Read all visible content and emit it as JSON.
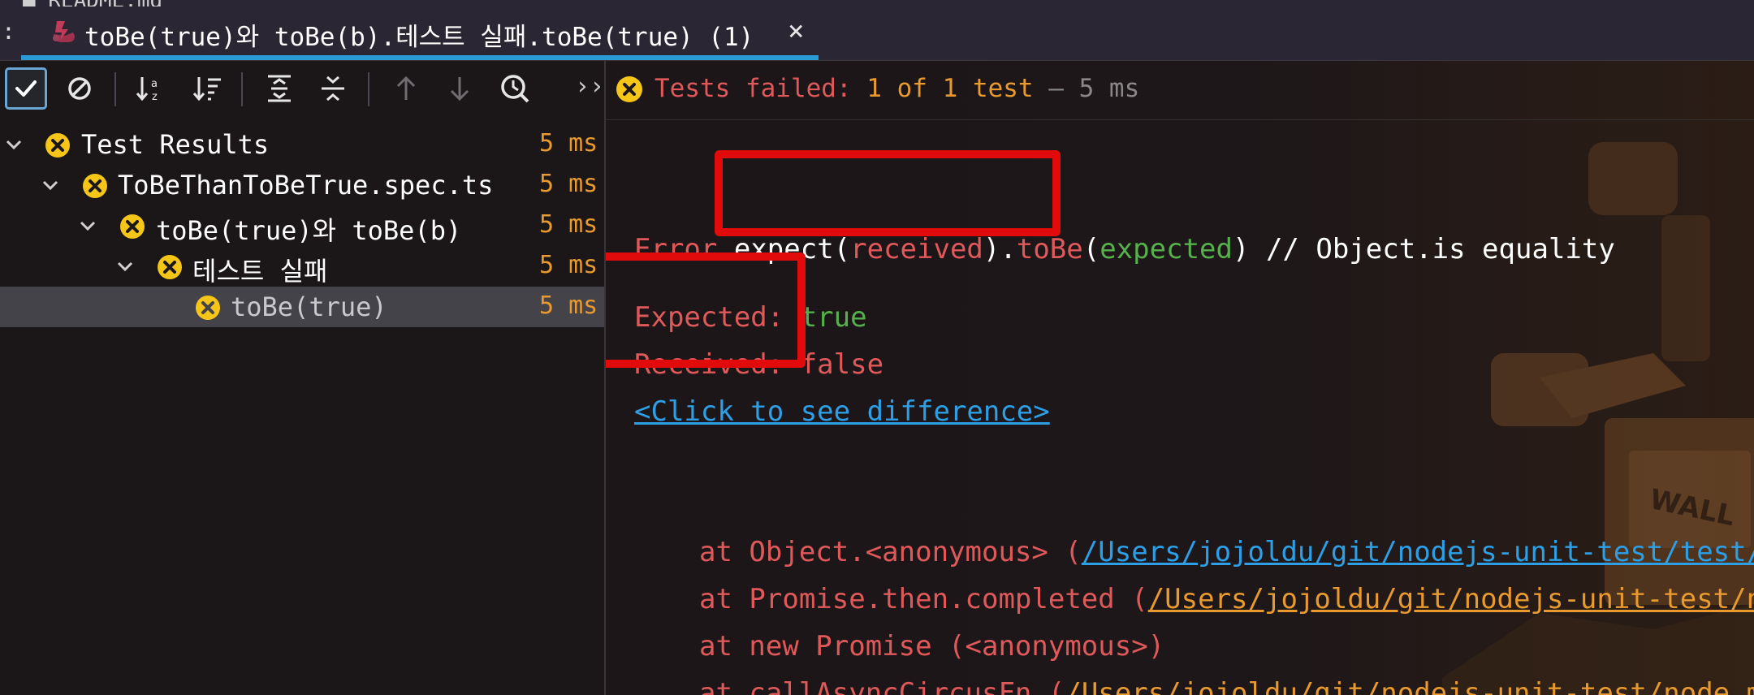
{
  "topstrip": {
    "partial_text": "■ README.md"
  },
  "tab": {
    "title": "toBe(true)와 toBe(b).테스트 실패.toBe(true) (1)",
    "close_glyph": "×",
    "menu_glyph": ":"
  },
  "toolbar": {
    "buttons": [
      {
        "icon": "checkmark-icon",
        "active": true
      },
      {
        "icon": "cancel-circle-icon"
      },
      {
        "icon": "sort-alphabetical-icon"
      },
      {
        "icon": "sort-by-duration-icon"
      },
      {
        "icon": "expand-all-icon"
      },
      {
        "icon": "collapse-all-icon"
      },
      {
        "icon": "arrow-up-icon",
        "disabled": true
      },
      {
        "icon": "arrow-down-icon",
        "disabled": true
      },
      {
        "icon": "history-icon"
      }
    ],
    "more_glyph": "››"
  },
  "tree": {
    "items": [
      {
        "label": "Test Results",
        "duration": "5 ms",
        "level": 0
      },
      {
        "label": "ToBeThanToBeTrue.spec.ts",
        "duration": "5 ms",
        "level": 1
      },
      {
        "label": "toBe(true)와 toBe(b)",
        "duration": "5 ms",
        "level": 2
      },
      {
        "label": "테스트 실패",
        "duration": "5 ms",
        "level": 3
      },
      {
        "label": "toBe(true)",
        "duration": "5 ms",
        "level": 4,
        "selected": true
      }
    ]
  },
  "status": {
    "prefix": "Tests failed: ",
    "count": "1 of 1 test",
    "sep": " – ",
    "time": "5 ms"
  },
  "console": {
    "error_label": "Error",
    "expect_fn": "expect(",
    "received_arg": "received",
    "close_paren1": ").",
    "tobe_fn": "toBe",
    "open_paren": "(",
    "expected_arg": "expected",
    "close_paren2": ")",
    "comment": " // Object.is equality",
    "expected_label": "Expected: ",
    "expected_value": "true",
    "received_label": "Received: ",
    "received_value": "false",
    "diff_link": "<Click to see difference>",
    "stack": [
      {
        "prefix": "at Object.<anonymous> (",
        "link": "/Users/jojoldu/git/nodejs-unit-test/test/t",
        "link_color": "blue"
      },
      {
        "prefix": "at Promise.then.completed (",
        "link": "/Users/jojoldu/git/nodejs-unit-test/no",
        "link_color": "orange"
      },
      {
        "prefix": "at new Promise (<anonymous>)",
        "link": "",
        "link_color": "none"
      },
      {
        "prefix": "at callAsyncCircusFn (",
        "link": "/Users/jojoldu/git/nodejs-unit-test/node_mo",
        "link_color": "orange"
      }
    ]
  },
  "colors": {
    "fail_icon": "#f5c518",
    "error_red": "#e0595a",
    "duration_orange": "#e89a2f",
    "value_green": "#56b04c",
    "link_blue": "#2d9fe6",
    "highlight_red": "#e10b0b",
    "tab_underline": "#2b9bd6"
  }
}
